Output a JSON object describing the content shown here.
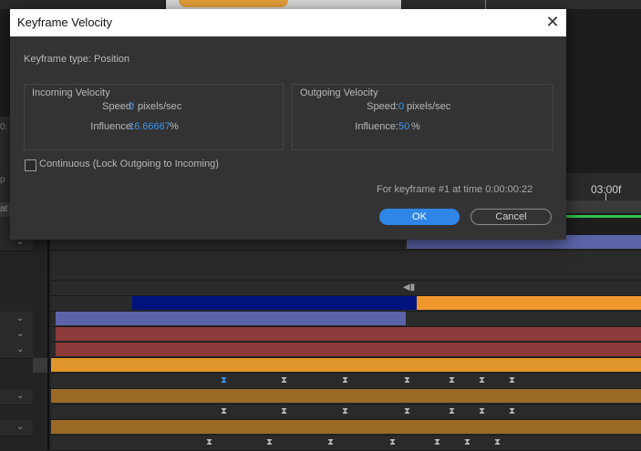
{
  "dialog": {
    "title": "Keyframe Velocity",
    "close_icon": "close-icon",
    "keyframe_type": "Keyframe type: Position",
    "incoming": {
      "title": "Incoming Velocity",
      "speed_label": "Speed:",
      "speed_value": "0",
      "speed_unit": "pixels/sec",
      "influence_label": "Influence:",
      "influence_value": "16.66667",
      "influence_unit": "%"
    },
    "outgoing": {
      "title": "Outgoing Velocity",
      "speed_label": "Speed:",
      "speed_value": "0",
      "speed_unit": "pixels/sec",
      "influence_label": "Influence:",
      "influence_value": "50",
      "influence_unit": "%"
    },
    "continuous_label": "Continuous (Lock Outgoing to Incoming)",
    "continuous_checked": false,
    "keyframe_info": "For keyframe #1 at time 0:00:00:22",
    "ok_label": "OK",
    "cancel_label": "Cancel"
  },
  "timeline": {
    "ruler_label": "03:00f",
    "left_text_1": "0:",
    "left_text_2": "p",
    "left_text_3": "at"
  },
  "colors": {
    "accent": "#2f86e6",
    "value_blue": "#3b97ef",
    "layer_orange": "#e7962e",
    "layer_red": "#8c3a3a",
    "layer_periwinkle": "#5b64a8",
    "layer_navy": "#00127e",
    "play_range_green": "#2fc44b"
  }
}
